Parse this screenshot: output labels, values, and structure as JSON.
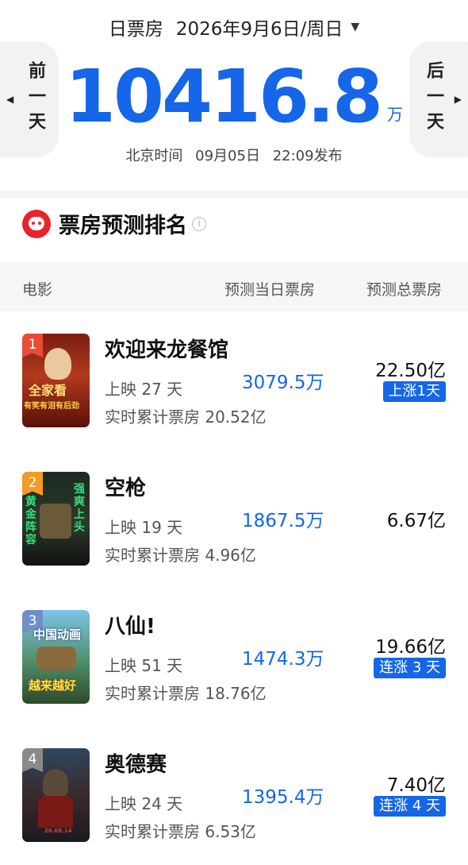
{
  "header": {
    "label": "日票房",
    "date": "2026年9月6日/周日",
    "prev_label": "前一天",
    "next_label": "后一天",
    "total_value": "10416.8",
    "total_unit": "万",
    "publish_prefix": "北京时间",
    "publish_date": "09月05日",
    "publish_time": "22:09发布"
  },
  "section": {
    "title": "票房预测排名"
  },
  "columns": {
    "movie": "电影",
    "day": "预测当日票房",
    "total": "预测总票房"
  },
  "movies": [
    {
      "rank": "1",
      "title": "欢迎来龙餐馆",
      "days": "上映 27 天",
      "cumulative": "实时累计票房 20.52亿",
      "day_bo": "3079.5万",
      "total_bo": "22.50亿",
      "badge": "上涨1天",
      "poster_text": "全家看",
      "poster_sub": "有笑有泪有后劲"
    },
    {
      "rank": "2",
      "title": "空枪",
      "days": "上映 19 天",
      "cumulative": "实时累计票房 4.96亿",
      "day_bo": "1867.5万",
      "total_bo": "6.67亿",
      "badge": "",
      "poster_text": "黄金阵容",
      "poster_sub": "强爽上头"
    },
    {
      "rank": "3",
      "title": "八仙!",
      "days": "上映 51 天",
      "cumulative": "实时累计票房 18.76亿",
      "day_bo": "1474.3万",
      "total_bo": "19.66亿",
      "badge": "连涨 3 天",
      "poster_text": "中国动画",
      "poster_sub": "越来越好"
    },
    {
      "rank": "4",
      "title": "奥德赛",
      "days": "上映 24 天",
      "cumulative": "实时累计票房 6.53亿",
      "day_bo": "1395.4万",
      "total_bo": "7.40亿",
      "badge": "连涨 4 天",
      "poster_text": "",
      "poster_sub": "26.08.14"
    }
  ],
  "colors": {
    "accent": "#1566e8",
    "rank1": "#e94b35",
    "rank2": "#f59a23",
    "rank3": "#6f8fc8",
    "rank4": "#8a8a8a"
  }
}
